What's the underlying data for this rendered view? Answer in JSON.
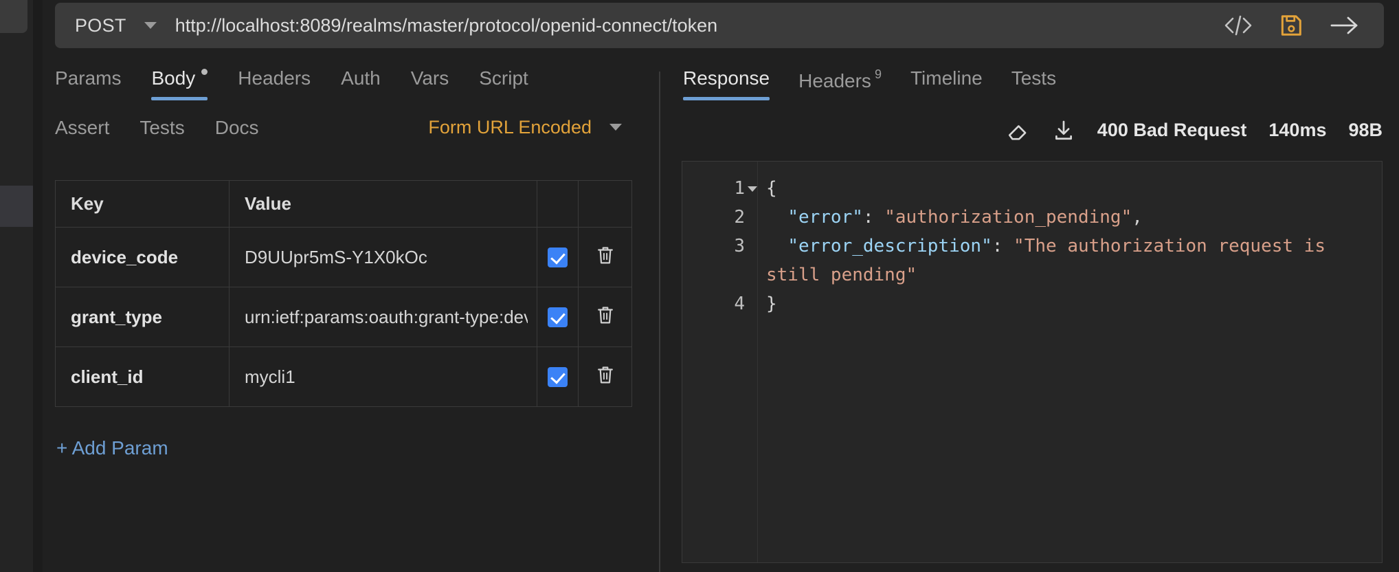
{
  "request_bar": {
    "method": "POST",
    "url": "http://localhost:8089/realms/master/protocol/openid-connect/token",
    "icons": {
      "code": "code-brackets-icon",
      "save": "save-floppy-icon",
      "send": "send-arrow-icon"
    },
    "accent_save_color": "#e3a33a"
  },
  "request_tabs_row1": [
    {
      "label": "Params",
      "active": false,
      "dot": false
    },
    {
      "label": "Body",
      "active": true,
      "dot": true
    },
    {
      "label": "Headers",
      "active": false,
      "dot": false
    },
    {
      "label": "Auth",
      "active": false,
      "dot": false
    },
    {
      "label": "Vars",
      "active": false,
      "dot": false
    },
    {
      "label": "Script",
      "active": false,
      "dot": false
    }
  ],
  "request_tabs_row2": [
    {
      "label": "Assert",
      "active": false
    },
    {
      "label": "Tests",
      "active": false
    },
    {
      "label": "Docs",
      "active": false
    }
  ],
  "body_type": {
    "label": "Form URL Encoded",
    "color": "#e3a33a"
  },
  "params_table": {
    "headers": [
      "Key",
      "Value",
      "",
      ""
    ],
    "rows": [
      {
        "key": "device_code",
        "value": "D9UUpr5mS-Y1X0kOc",
        "enabled": true
      },
      {
        "key": "grant_type",
        "value": "urn:ietf:params:oauth:grant-type:device_code",
        "enabled": true
      },
      {
        "key": "client_id",
        "value": "mycli1",
        "enabled": true
      }
    ]
  },
  "add_param_label": "+ Add Param",
  "response_tabs": [
    {
      "label": "Response",
      "active": true,
      "badge": ""
    },
    {
      "label": "Headers",
      "active": false,
      "badge": "9"
    },
    {
      "label": "Timeline",
      "active": false,
      "badge": ""
    },
    {
      "label": "Tests",
      "active": false,
      "badge": ""
    }
  ],
  "response_status": {
    "clear_icon": "eraser-icon",
    "download_icon": "download-icon",
    "status": "400 Bad Request",
    "time": "140ms",
    "size": "98B"
  },
  "response_body": {
    "line_numbers": [
      "1",
      "2",
      "3",
      "4"
    ],
    "json": {
      "error": "authorization_pending",
      "error_description": "The authorization request is still pending"
    },
    "raw": "{\n  \"error\": \"authorization_pending\",\n  \"error_description\": \"The authorization request is still pending\"\n}"
  },
  "theme": {
    "background": "#202020",
    "panel": "#262626",
    "accent_blue": "#6e9fd4",
    "accent_orange": "#e3a33a",
    "checkbox_blue": "#3b82f6",
    "json_key": "#9cd4f5",
    "json_string": "#d9a08a"
  }
}
